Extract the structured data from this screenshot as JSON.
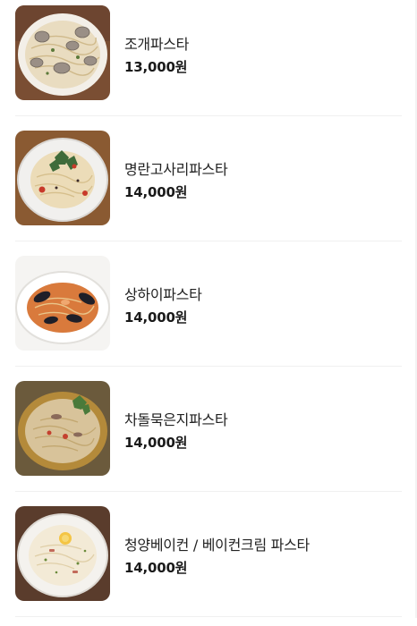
{
  "menu": {
    "items": [
      {
        "name": "조개파스타",
        "price": "13,000원",
        "image_icon": "clam-pasta-photo"
      },
      {
        "name": "명란고사리파스타",
        "price": "14,000원",
        "image_icon": "pollock-roe-fern-pasta-photo"
      },
      {
        "name": "상하이파스타",
        "price": "14,000원",
        "image_icon": "shanghai-pasta-photo"
      },
      {
        "name": "차돌묵은지파스타",
        "price": "14,000원",
        "image_icon": "brisket-kimchi-pasta-photo"
      },
      {
        "name": "청양베이컨 / 베이컨크림 파스타",
        "price": "14,000원",
        "image_icon": "bacon-cream-pasta-photo"
      }
    ]
  }
}
